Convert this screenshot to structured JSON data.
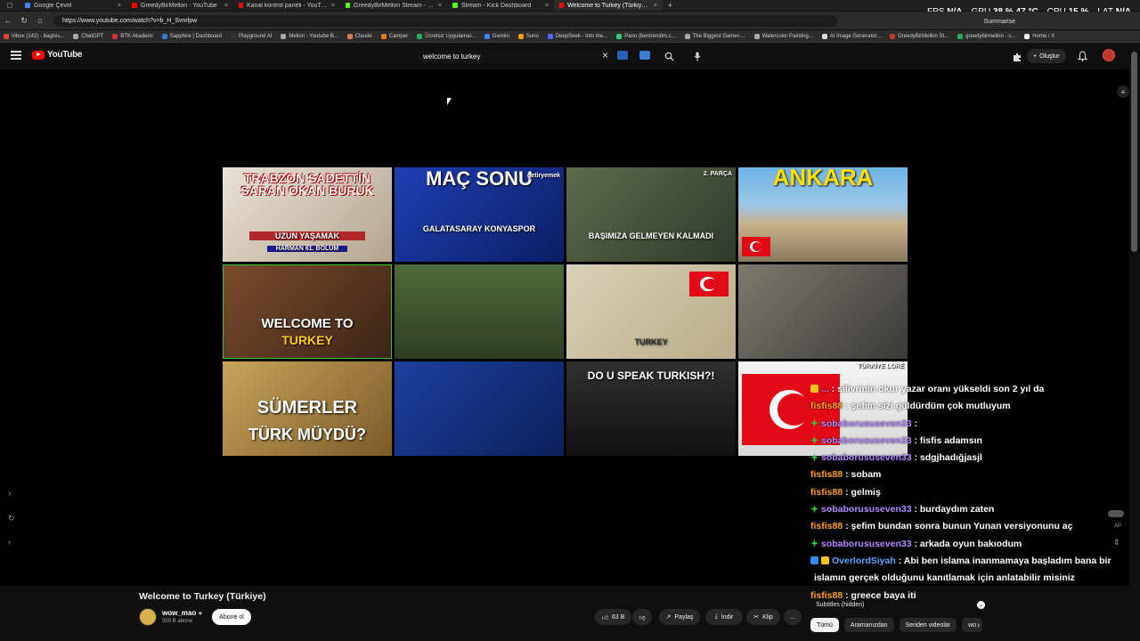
{
  "browser": {
    "tabs": [
      {
        "label": "Google Çevirl",
        "color": "#4285f4"
      },
      {
        "label": "GreedyBirMellon - YouTube",
        "color": "#ff0000"
      },
      {
        "label": "Kanal kontrol paneli - YouTube St...",
        "color": "#ff0000"
      },
      {
        "label": "GreedyBirMellon Stream - Watch...",
        "color": "#53fc18"
      },
      {
        "label": "Stream - Kick Dashboard",
        "color": "#53fc18"
      },
      {
        "label": "Welcome to Turkey (Türkiye) - Yo...",
        "color": "#ff0000"
      }
    ],
    "new_tab": "+",
    "url": "https://www.youtube.com/watch?v=b_H_Svnrlpw",
    "summarise": "Summarise",
    "stats": [
      {
        "label": "FPS",
        "value": "N/A"
      },
      {
        "label": "GPU",
        "value": "38 % 47 °C"
      },
      {
        "label": "CPU",
        "value": "15 %"
      },
      {
        "label": "LAT",
        "value": "N/A"
      }
    ],
    "bookmarks": [
      {
        "label": "Inbox (142) - bagisis...",
        "color": "#ea4335"
      },
      {
        "label": "ChatGPT",
        "color": "#aaaaaa"
      },
      {
        "label": "BTK Akademi",
        "color": "#d03030"
      },
      {
        "label": "Sapphire | Dashboard",
        "color": "#3a7bd5"
      },
      {
        "label": "Playground AI",
        "color": "#333333"
      },
      {
        "label": "Mellon - Youtube B...",
        "color": "#aaaaaa"
      },
      {
        "label": "Claude",
        "color": "#d97757"
      },
      {
        "label": "Camper",
        "color": "#e67e22"
      },
      {
        "label": "Ücretsiz Uygulamal...",
        "color": "#27ae60"
      },
      {
        "label": "Gemini",
        "color": "#4285f4"
      },
      {
        "label": "Suno",
        "color": "#f39c12"
      },
      {
        "label": "DeepSeek - Into the...",
        "color": "#4d6bfe"
      },
      {
        "label": "Pano (bentrendim.c...",
        "color": "#2ecc71"
      },
      {
        "label": "The Biggest Gamer-...",
        "color": "#aaaaaa"
      },
      {
        "label": "Watercolor Painting...",
        "color": "#aaaaaa"
      },
      {
        "label": "AI Image Generator...",
        "color": "#dddddd"
      },
      {
        "label": "GreedyBirMellon St...",
        "color": "#c0392b"
      },
      {
        "label": "greedybirmellon - s...",
        "color": "#27ae60"
      },
      {
        "label": "Home / X",
        "color": "#ffffff"
      }
    ]
  },
  "youtube": {
    "logo": "YouTube",
    "search_value": "welcome to turkey",
    "create_label": "Oluştur"
  },
  "thumbnails": [
    {
      "text": "TRABZON SADETTİN SARAN OKAN BURUK",
      "sub": "UZUN YAŞAMAK",
      "tag": "HARMAN 61. BÖLÜM"
    },
    {
      "text": "MAÇ SONU",
      "sub": "GALATASARAY KONYASPOR",
      "tag": "getiryemek"
    },
    {
      "text": "",
      "sub": "BAŞIMIZA GELMEYEN KALMADI",
      "tag": "2. PARÇA"
    },
    {
      "text": "ANKARA",
      "sub": "",
      "tag": ""
    },
    {
      "text": "WELCOME TO",
      "sub": "TURKEY",
      "tag": ""
    },
    {
      "text": "",
      "sub": "",
      "tag": ""
    },
    {
      "text": "",
      "sub": "TURKEY",
      "tag": ""
    },
    {
      "text": "",
      "sub": "",
      "tag": ""
    },
    {
      "text": "SÜMERLER",
      "sub": "TÜRK MÜYDÜ?",
      "tag": ""
    },
    {
      "text": "",
      "sub": "",
      "tag": ""
    },
    {
      "text": "DO U SPEAK TURKISH?!",
      "sub": "",
      "tag": ""
    },
    {
      "text": "",
      "sub": "",
      "tag": "TÜRKİYE LORE"
    }
  ],
  "chat": [
    {
      "badges": [
        "y"
      ],
      "user": "...",
      "user_color": "#b388ff",
      "text": "silivrinin okur yazar oranı yükseldi son 2 yıl da"
    },
    {
      "badges": [],
      "user": "fisfis88",
      "user_color": "#ff9f1a",
      "text": "şefim sizi güldürdüm çok mutluyum"
    },
    {
      "badges": [
        "g"
      ],
      "user": "sobaborususeven33",
      "user_color": "#b388ff",
      "text": ""
    },
    {
      "badges": [
        "g"
      ],
      "user": "sobaborususeven33",
      "user_color": "#b388ff",
      "text": "fisfis adamsın"
    },
    {
      "badges": [
        "g"
      ],
      "user": "sobaborususeven33",
      "user_color": "#b388ff",
      "text": "sdgjhadığjasjl"
    },
    {
      "badges": [],
      "user": "fisfis88",
      "user_color": "#ff9f1a",
      "text": "sobam"
    },
    {
      "badges": [],
      "user": "fisfis88",
      "user_color": "#ff9f1a",
      "text": "gelmiş"
    },
    {
      "badges": [
        "g"
      ],
      "user": "sobaborususeven33",
      "user_color": "#b388ff",
      "text": "burdaydım zaten"
    },
    {
      "badges": [],
      "user": "fisfis88",
      "user_color": "#ff9f1a",
      "text": "şefim bundan sonra bunun Yunan versiyonunu aç"
    },
    {
      "badges": [
        "g"
      ],
      "user": "sobaborususeven33",
      "user_color": "#b388ff",
      "text": "arkada oyun bakıodum"
    },
    {
      "badges": [
        "b",
        "y"
      ],
      "user": "OverlordSiyah",
      "user_color": "#5aa9ff",
      "text": "Abi ben islama inanmamaya başladım bana bir"
    },
    {
      "badges": [],
      "user": "",
      "user_color": "#ffffff",
      "text": "islamın gerçek olduğunu kanıtlamak için anlatabilir misiniz"
    },
    {
      "badges": [],
      "user": "fisfis88",
      "user_color": "#ff9f1a",
      "text": "greece baya iti"
    }
  ],
  "subtitles_hidden": "Subtitles (hidden)",
  "ap_label": "AP",
  "video": {
    "title": "Welcome to Turkey (Türkiye)",
    "channel": "wow_mao",
    "subs": "359 B abone",
    "subscribe": "Abone ol",
    "likes": "63 B",
    "share": "Paylaş",
    "download": "İndir",
    "clip": "Klip",
    "more": "..."
  },
  "chips": [
    "Tümü",
    "Aramanızdan",
    "Seriden videolar",
    "wo"
  ]
}
